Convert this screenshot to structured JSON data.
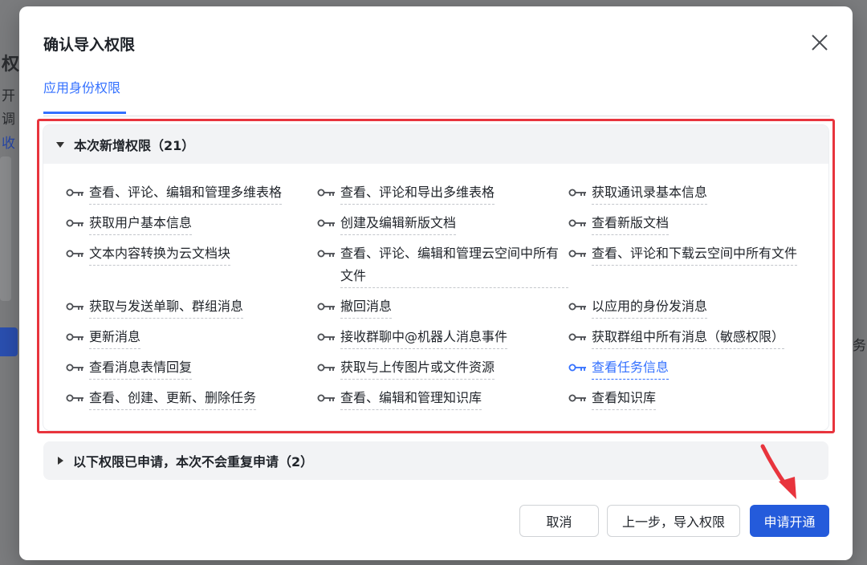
{
  "background": {
    "heading_char": "权",
    "lines": [
      "开",
      "调",
      "收"
    ],
    "right_fragment": "务"
  },
  "modal": {
    "title": "确认导入权限",
    "close_icon": "close-icon",
    "tab_active": "应用身份权限"
  },
  "new_permissions": {
    "header": "本次新增权限（21）",
    "items": [
      {
        "label": "查看、评论、编辑和管理多维表格",
        "link": false
      },
      {
        "label": "查看、评论和导出多维表格",
        "link": false
      },
      {
        "label": "获取通讯录基本信息",
        "link": false
      },
      {
        "label": "获取用户基本信息",
        "link": false
      },
      {
        "label": "创建及编辑新版文档",
        "link": false
      },
      {
        "label": "查看新版文档",
        "link": false
      },
      {
        "label": "文本内容转换为云文档块",
        "link": false
      },
      {
        "label": "查看、评论、编辑和管理云空间中所有文件",
        "link": false
      },
      {
        "label": "查看、评论和下载云空间中所有文件",
        "link": false
      },
      {
        "label": "获取与发送单聊、群组消息",
        "link": false
      },
      {
        "label": "撤回消息",
        "link": false
      },
      {
        "label": "以应用的身份发消息",
        "link": false
      },
      {
        "label": "更新消息",
        "link": false
      },
      {
        "label": "接收群聊中@机器人消息事件",
        "link": false
      },
      {
        "label": "获取群组中所有消息（敏感权限）",
        "link": false
      },
      {
        "label": "查看消息表情回复",
        "link": false
      },
      {
        "label": "获取与上传图片或文件资源",
        "link": false
      },
      {
        "label": "查看任务信息",
        "link": true
      },
      {
        "label": "查看、创建、更新、删除任务",
        "link": false
      },
      {
        "label": "查看、编辑和管理知识库",
        "link": false
      },
      {
        "label": "查看知识库",
        "link": false
      }
    ]
  },
  "applied_permissions": {
    "header": "以下权限已申请，本次不会重复申请（2）"
  },
  "footer": {
    "cancel": "取消",
    "back": "上一步，导入权限",
    "apply": "申请开通"
  },
  "colors": {
    "accent": "#3370ff",
    "primary_button": "#245bdb",
    "highlight_border": "#e8343d"
  }
}
